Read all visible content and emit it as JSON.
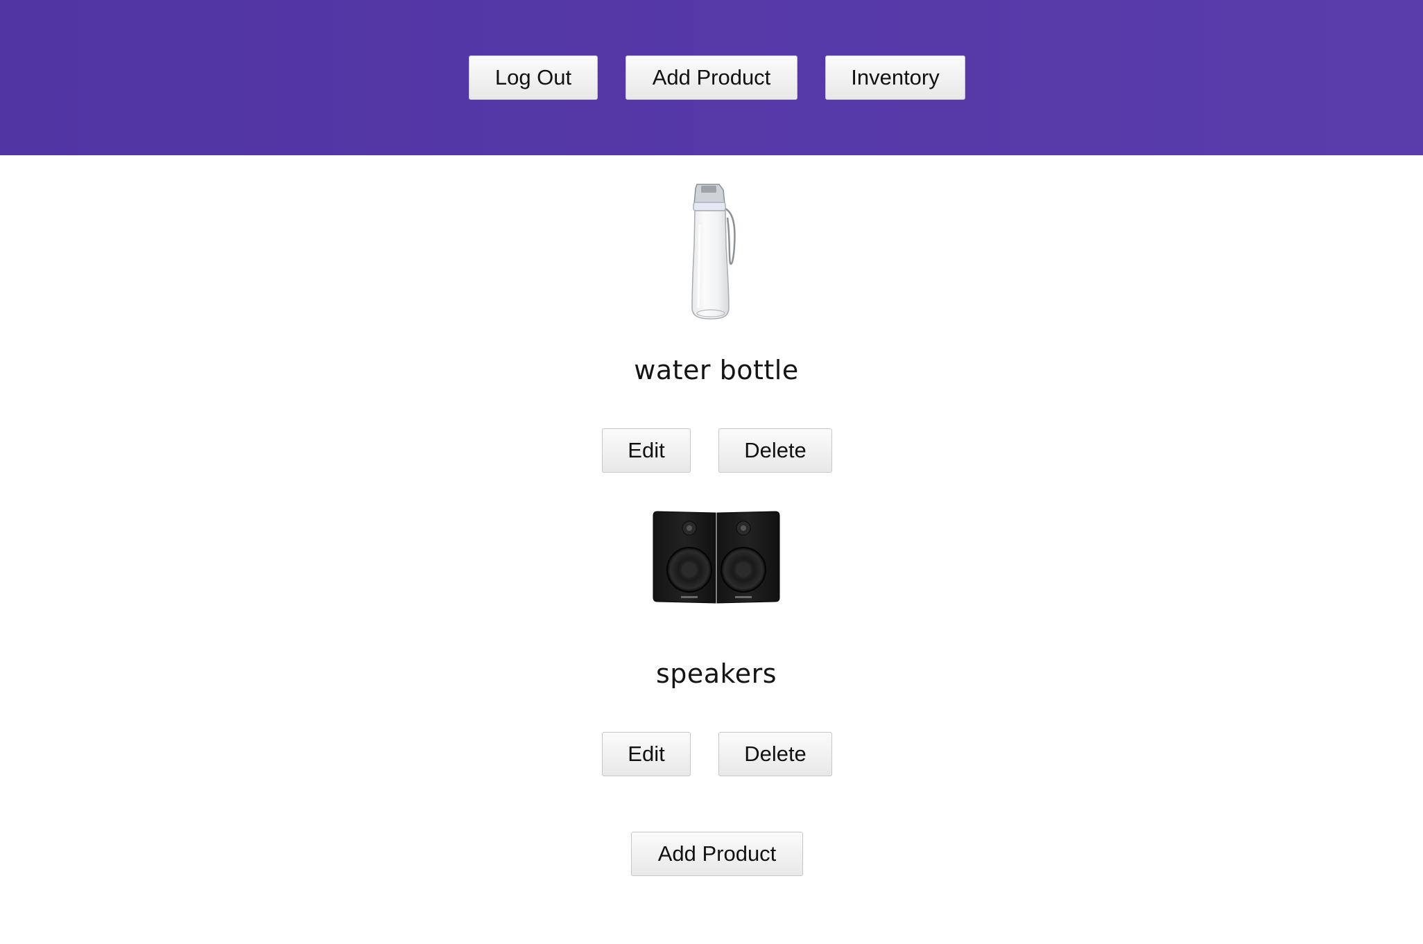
{
  "nav": {
    "logout_label": "Log Out",
    "add_product_label": "Add Product",
    "inventory_label": "Inventory"
  },
  "products": [
    {
      "name": "water bottle",
      "image_icon": "water-bottle-image",
      "edit_label": "Edit",
      "delete_label": "Delete"
    },
    {
      "name": "speakers",
      "image_icon": "speakers-image",
      "edit_label": "Edit",
      "delete_label": "Delete"
    }
  ],
  "footer": {
    "add_product_label": "Add Product"
  },
  "colors": {
    "header_bg": "#5437a6",
    "button_bg": "#f0f0f0",
    "text": "#141414"
  }
}
